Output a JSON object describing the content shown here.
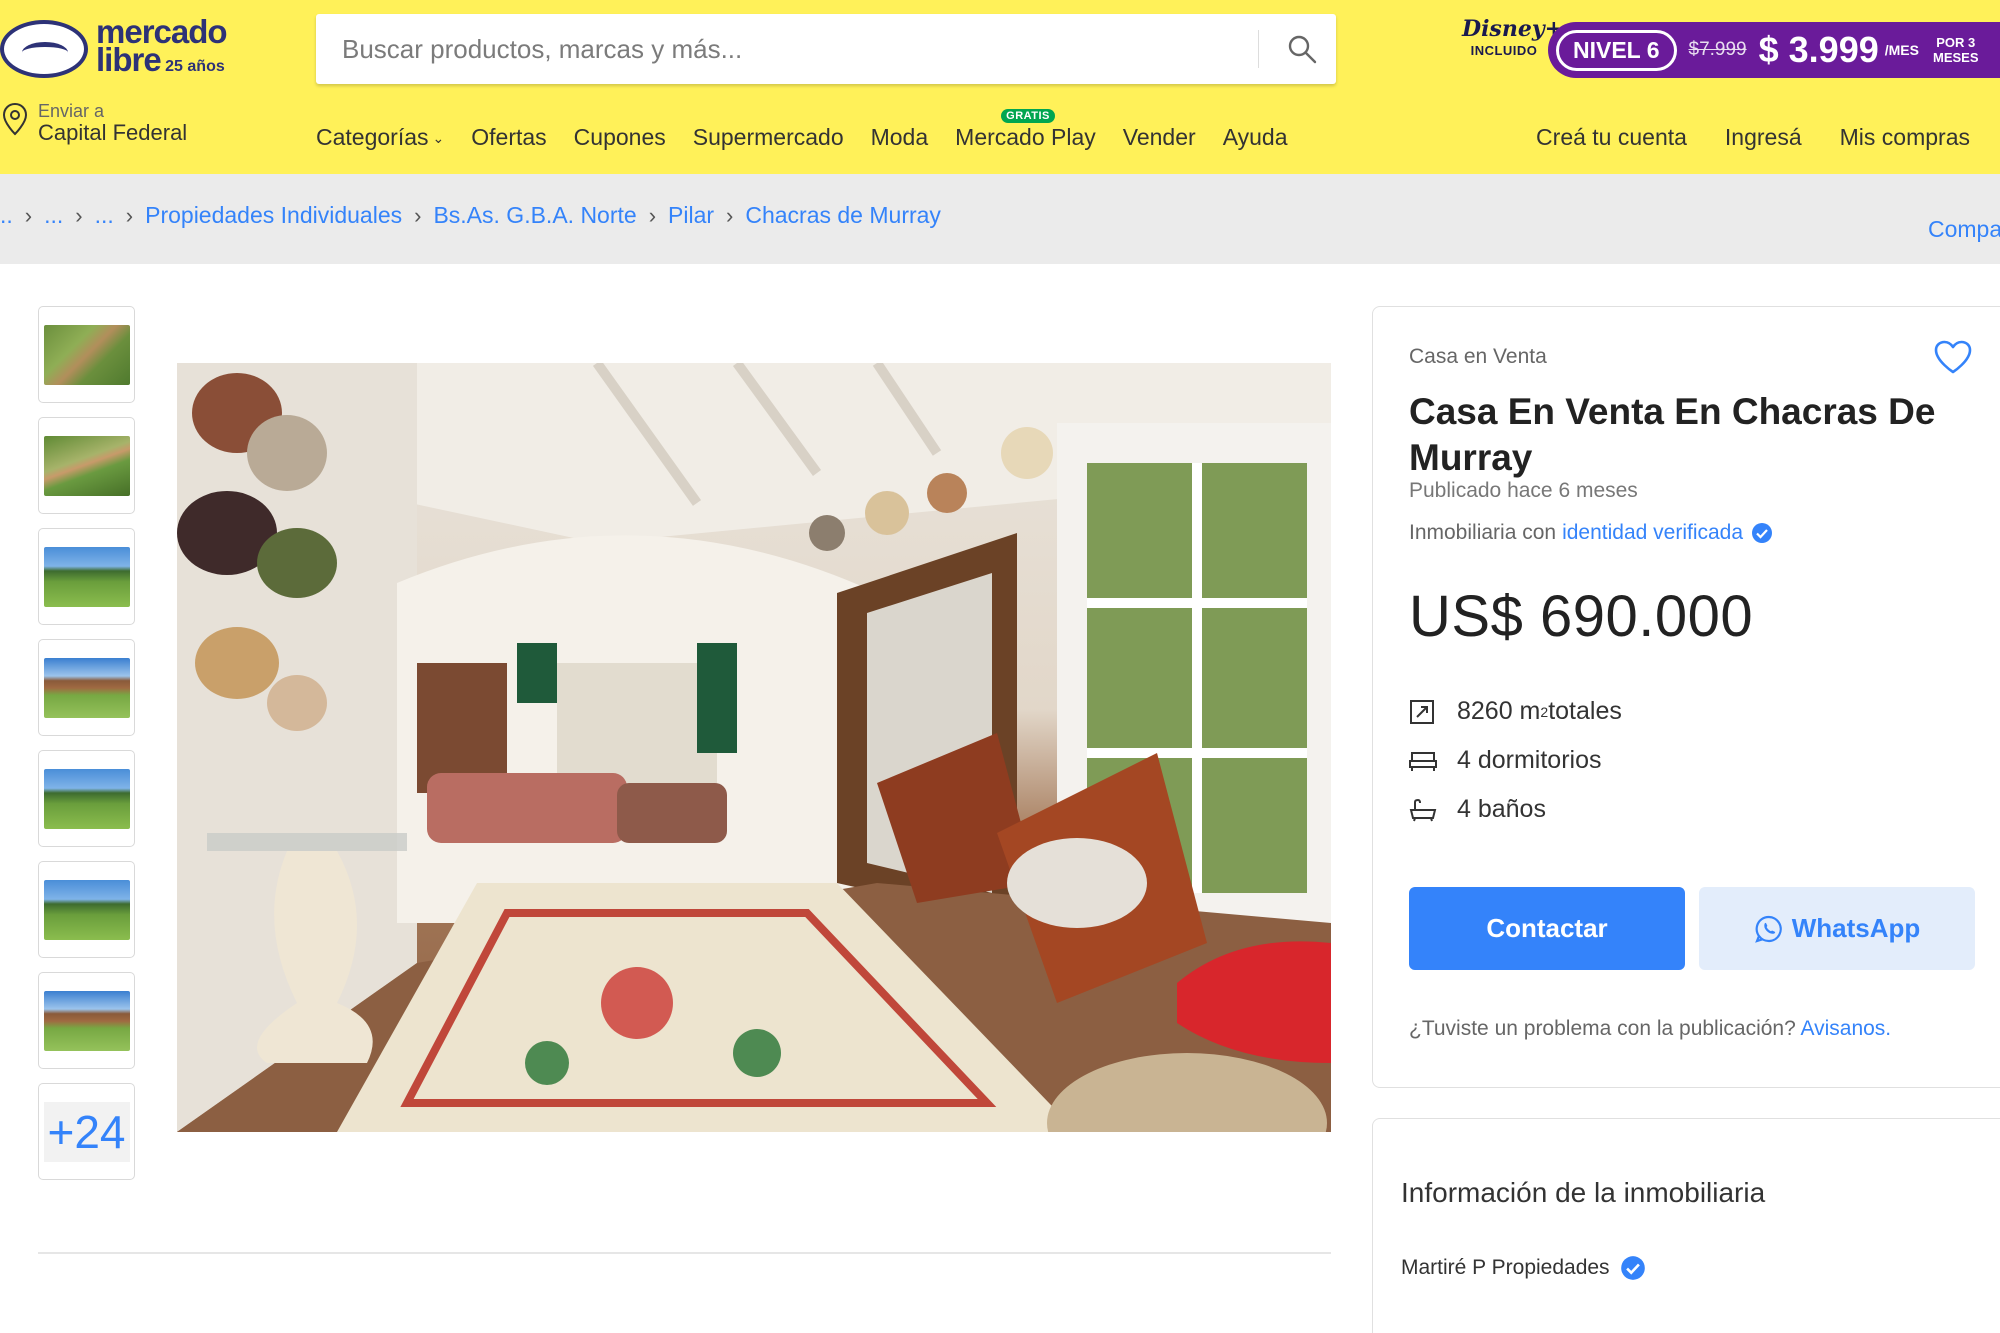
{
  "header": {
    "logo": {
      "line1": "mercado",
      "line2": "libre",
      "anniversary": "25 años"
    },
    "search": {
      "placeholder": "Buscar productos, marcas y más..."
    },
    "promo": {
      "disney_brand": "Disney+",
      "disney_included": "INCLUIDO",
      "level": "NIVEL 6",
      "old_price": "$7.999",
      "price": "$ 3.999",
      "per": "/MES",
      "period_line1": "POR 3",
      "period_line2": "MESES",
      "accent_color": "#6a1b9a"
    },
    "location": {
      "label": "Enviar a",
      "value": "Capital Federal"
    },
    "nav": [
      {
        "label": "Categorías",
        "icon": "chevron-down-icon"
      },
      {
        "label": "Ofertas"
      },
      {
        "label": "Cupones"
      },
      {
        "label": "Supermercado"
      },
      {
        "label": "Moda"
      },
      {
        "label": "Mercado Play",
        "badge": "GRATIS"
      },
      {
        "label": "Vender"
      },
      {
        "label": "Ayuda"
      }
    ],
    "account": [
      {
        "label": "Creá tu cuenta"
      },
      {
        "label": "Ingresá"
      },
      {
        "label": "Mis compras"
      }
    ],
    "bg_color": "#fff159"
  },
  "breadcrumb": {
    "items": [
      "..",
      "...",
      "...",
      "Propiedades Individuales",
      "Bs.As. G.B.A. Norte",
      "Pilar",
      "Chacras de Murray"
    ],
    "share_label": "Compa"
  },
  "gallery": {
    "thumbnails": [
      {
        "icon": "aerial-photo-thumb"
      },
      {
        "icon": "aerial-photo-thumb"
      },
      {
        "icon": "lawn-photo-thumb"
      },
      {
        "icon": "house-photo-thumb"
      },
      {
        "icon": "lawn-photo-thumb"
      },
      {
        "icon": "lawn-photo-thumb"
      },
      {
        "icon": "house-photo-thumb"
      }
    ],
    "more_count": "+24",
    "main_photo": {
      "icon": "living-room-photo"
    }
  },
  "listing": {
    "subtitle": "Casa en Venta",
    "title": "Casa En Venta En Chacras De Murray",
    "published": "Publicado hace 6 meses",
    "agency_prefix": "Inmobiliaria con",
    "agency_link": "identidad verificada",
    "price": "US$ 690.000",
    "features": [
      {
        "icon": "area-icon",
        "value": "8260 m",
        "sup": "2",
        "suffix": " totales"
      },
      {
        "icon": "bed-icon",
        "value": "4 dormitorios"
      },
      {
        "icon": "bath-icon",
        "value": "4 baños"
      }
    ],
    "contact_label": "Contactar",
    "whatsapp_label": "WhatsApp",
    "report_text": "¿Tuviste un problema con la publicación?",
    "report_link": "Avisanos.",
    "primary_color": "#3483fa"
  },
  "agency_info": {
    "title": "Información de la inmobiliaria",
    "name": "Martiré P Propiedades"
  }
}
